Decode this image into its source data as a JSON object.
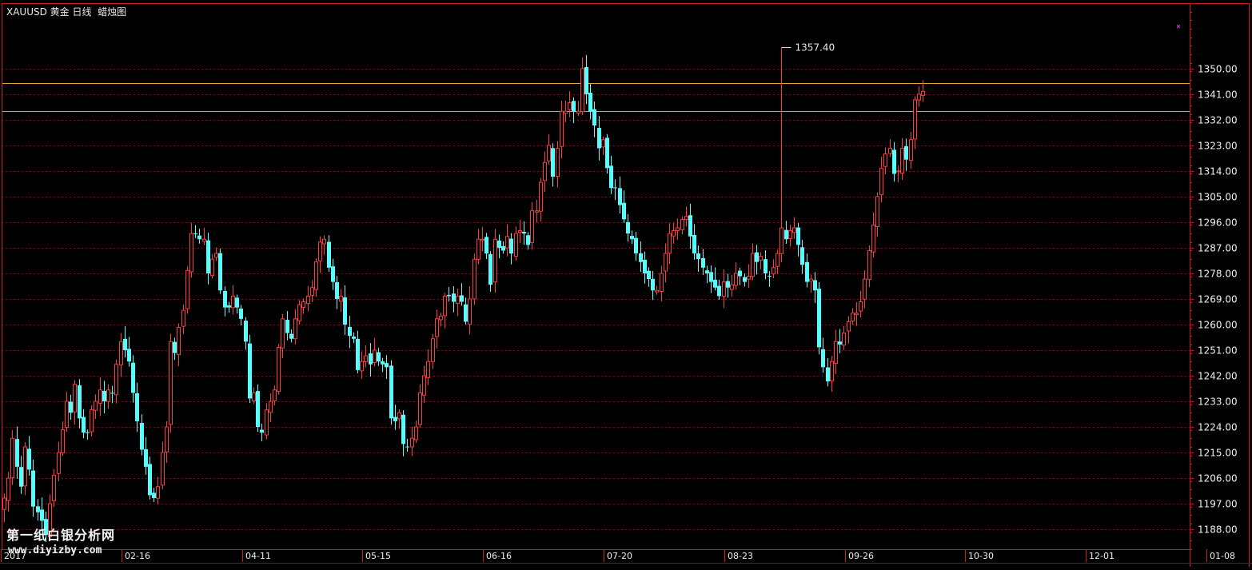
{
  "header": {
    "title": "XAUUSD 黄金 日线  蜡烛图"
  },
  "watermark": {
    "line1": "第一纸白银分析网",
    "line2": "www.diyizby.com"
  },
  "colors": {
    "up": "#ff3b3b",
    "down": "#54ffff",
    "grid": "#7a1414",
    "frame": "#c81e1e",
    "axis_text": "#f0f0f0",
    "level_line": "#e8a23a",
    "marker": "#d040d0"
  },
  "chart_data": {
    "type": "candlestick",
    "title": "XAUUSD 黄金 日线  蜡烛图",
    "ylim": [
      1181,
      1373
    ],
    "y_ticks": [
      1188,
      1197,
      1206,
      1215,
      1224,
      1233,
      1242,
      1251,
      1260,
      1269,
      1278,
      1287,
      1296,
      1305,
      1314,
      1323,
      1332,
      1341,
      1350
    ],
    "y_tick_labels": [
      "1188.00",
      "1197.00",
      "1206.00",
      "1215.00",
      "1224.00",
      "1233.00",
      "1242.00",
      "1251.00",
      "1260.00",
      "1269.00",
      "1278.00",
      "1287.00",
      "1296.00",
      "1305.00",
      "1314.00",
      "1323.00",
      "1332.00",
      "1341.00",
      "1350.00"
    ],
    "x_labels": [
      {
        "label": "2017",
        "index": 0
      },
      {
        "label": "02-16",
        "index": 29
      },
      {
        "label": "04-11",
        "index": 58
      },
      {
        "label": "05-15",
        "index": 87
      },
      {
        "label": "06-16",
        "index": 116
      },
      {
        "label": "07-20",
        "index": 145
      },
      {
        "label": "08-23",
        "index": 174
      },
      {
        "label": "09-26",
        "index": 203
      },
      {
        "label": "10-30",
        "index": 232
      },
      {
        "label": "12-01",
        "index": 261
      },
      {
        "label": "01-08",
        "index": 290
      }
    ],
    "horizontal_levels": [
      1345.0,
      1335.0
    ],
    "annotation": {
      "label": "1357.40",
      "value": 1357.4,
      "index": 187
    },
    "closes": [
      1199,
      1206,
      1220,
      1210,
      1203,
      1217,
      1209,
      1196,
      1194,
      1191,
      1186,
      1197,
      1207,
      1215,
      1223,
      1233,
      1229,
      1239,
      1227,
      1222,
      1222,
      1230,
      1233,
      1237,
      1233,
      1237,
      1236,
      1246,
      1254,
      1251,
      1247,
      1236,
      1226,
      1216,
      1210,
      1200,
      1199,
      1203,
      1215,
      1224,
      1254,
      1250,
      1259,
      1265,
      1279,
      1292,
      1292,
      1290,
      1290,
      1278,
      1283,
      1285,
      1272,
      1266,
      1266,
      1270,
      1266,
      1262,
      1254,
      1234,
      1236,
      1224,
      1222,
      1230,
      1233,
      1237,
      1252,
      1262,
      1257,
      1255,
      1262,
      1267,
      1268,
      1270,
      1273,
      1282,
      1289,
      1290,
      1280,
      1275,
      1269,
      1270,
      1260,
      1256,
      1255,
      1244,
      1247,
      1249,
      1246,
      1251,
      1247,
      1246,
      1245,
      1227,
      1226,
      1229,
      1218,
      1217,
      1220,
      1224,
      1236,
      1242,
      1247,
      1255,
      1262,
      1263,
      1270,
      1270,
      1268,
      1270,
      1268,
      1261,
      1269,
      1283,
      1290,
      1290,
      1285,
      1274,
      1290,
      1287,
      1286,
      1291,
      1285,
      1292,
      1293,
      1292,
      1288,
      1300,
      1300,
      1310,
      1317,
      1323,
      1312,
      1322,
      1335,
      1335,
      1338,
      1335,
      1335,
      1350,
      1341,
      1335,
      1330,
      1322,
      1325,
      1315,
      1308,
      1308,
      1302,
      1297,
      1292,
      1290,
      1285,
      1282,
      1278,
      1276,
      1272,
      1272,
      1278,
      1285,
      1292,
      1293,
      1294,
      1297,
      1298,
      1291,
      1285,
      1283,
      1280,
      1278,
      1275,
      1273,
      1270,
      1275,
      1273,
      1274,
      1278,
      1277,
      1275,
      1277,
      1285,
      1282,
      1284,
      1278,
      1277,
      1280,
      1285,
      1294,
      1290,
      1293,
      1294,
      1288,
      1281,
      1275,
      1276,
      1272,
      1252,
      1245,
      1240,
      1247,
      1254,
      1253,
      1257,
      1261,
      1264,
      1264,
      1268,
      1276,
      1286,
      1295,
      1305,
      1315,
      1320,
      1322,
      1313,
      1314,
      1322,
      1318,
      1325,
      1339,
      1341,
      1342
    ]
  }
}
